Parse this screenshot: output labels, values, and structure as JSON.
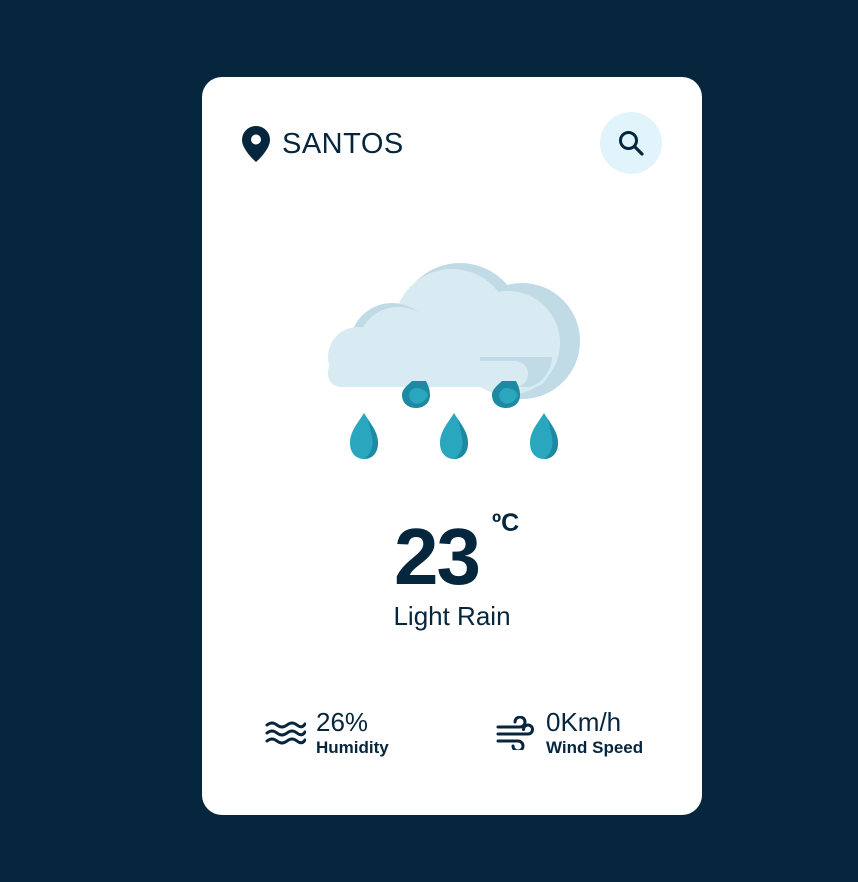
{
  "location": {
    "icon": "map-pin-icon",
    "city": "SANTOS"
  },
  "search": {
    "icon": "search-icon"
  },
  "weather": {
    "icon": "cloud-rain-icon",
    "temperature": "23",
    "unit": "ºC",
    "description": "Light Rain"
  },
  "stats": {
    "humidity": {
      "icon": "waves-icon",
      "value": "26%",
      "label": "Humidity"
    },
    "wind": {
      "icon": "wind-icon",
      "value": "0Km/h",
      "label": "Wind Speed"
    }
  },
  "colors": {
    "background": "#06263d",
    "card": "#ffffff",
    "text": "#06263d",
    "search_button": "#e1f4fc",
    "cloud": "#d9ebf2",
    "cloud_shadow": "#c0dbe6",
    "raindrop": "#2aa6bf",
    "raindrop_shadow": "#1d8aa3"
  }
}
